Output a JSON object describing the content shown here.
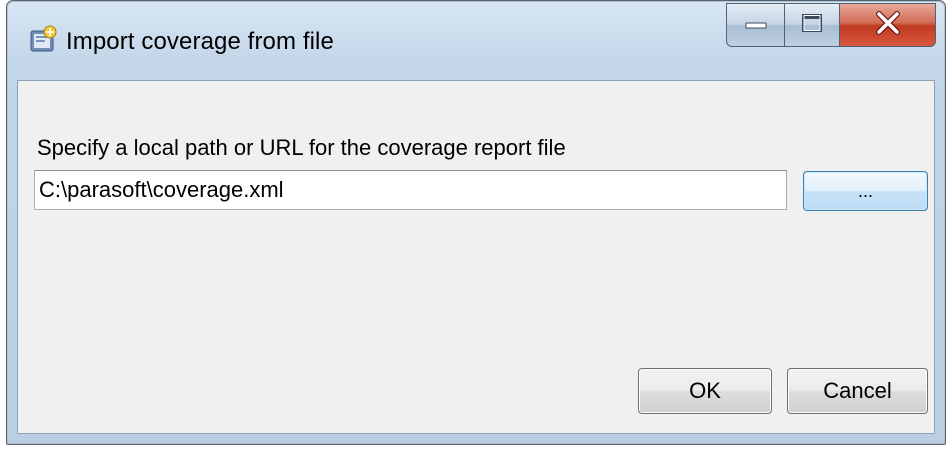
{
  "window": {
    "title": "Import coverage from file",
    "icon": "import-coverage-app-icon"
  },
  "caption": {
    "minimize_icon": "minimize-icon",
    "maximize_icon": "maximize-icon",
    "close_icon": "close-icon"
  },
  "dialog": {
    "prompt": "Specify a local path or URL for the coverage report file",
    "path_value": "C:\\parasoft\\coverage.xml",
    "browse_label": "...",
    "ok_label": "OK",
    "cancel_label": "Cancel"
  },
  "colors": {
    "close_button": "#c13a22",
    "focus_button_border": "#3c7fb1",
    "client_background": "#f0f0f0"
  }
}
